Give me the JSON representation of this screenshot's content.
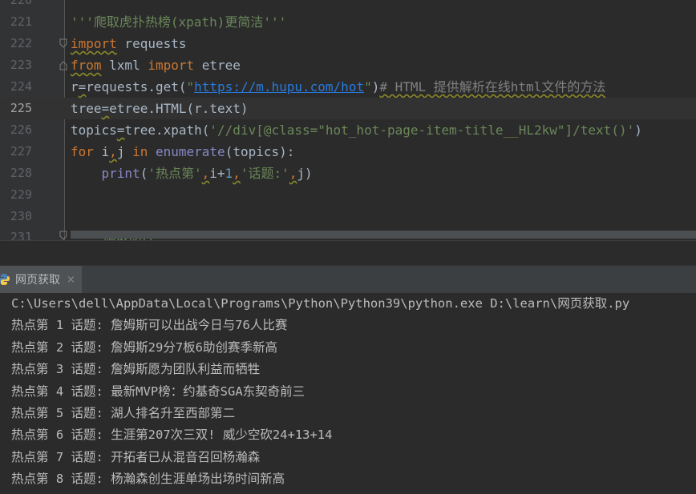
{
  "editor": {
    "partial_top_line_number": "220",
    "partial_bottom_line_number": "231",
    "partial_bottom_line_text": "'''爬取图片'''",
    "current_line": "225",
    "lines": [
      {
        "num": "221",
        "parts": [
          {
            "t": "'''爬取虎扑热榜(xpath)更简洁'''",
            "c": "str"
          }
        ]
      },
      {
        "num": "222",
        "parts": [
          {
            "t": "import",
            "c": "kw squig"
          },
          {
            "t": " requests",
            "c": ""
          }
        ]
      },
      {
        "num": "223",
        "parts": [
          {
            "t": "from",
            "c": "kw squig"
          },
          {
            "t": " lxml ",
            "c": ""
          },
          {
            "t": "import",
            "c": "kw"
          },
          {
            "t": " etree",
            "c": ""
          }
        ]
      },
      {
        "num": "224",
        "parts": [
          {
            "t": "r",
            "c": ""
          },
          {
            "t": "=",
            "c": "squig"
          },
          {
            "t": "requests.get(",
            "c": ""
          },
          {
            "t": "\"",
            "c": "str"
          },
          {
            "t": "https://m.hupu.com/hot",
            "c": "url"
          },
          {
            "t": "\"",
            "c": "str"
          },
          {
            "t": ")",
            "c": ""
          },
          {
            "t": "# HTML 提供解析在线html文件的方法",
            "c": "cmt squig"
          }
        ]
      },
      {
        "num": "225",
        "parts": [
          {
            "t": "tree",
            "c": ""
          },
          {
            "t": "=",
            "c": "squig"
          },
          {
            "t": "etree.HTML(r.text)",
            "c": ""
          }
        ]
      },
      {
        "num": "226",
        "parts": [
          {
            "t": "topics",
            "c": ""
          },
          {
            "t": "=",
            "c": "squig"
          },
          {
            "t": "tree.xpath(",
            "c": ""
          },
          {
            "t": "'//div[@class=\"hot_hot-page-item-title__HL2kw\"]/text()'",
            "c": "str"
          },
          {
            "t": ")",
            "c": ""
          }
        ]
      },
      {
        "num": "227",
        "parts": [
          {
            "t": "for",
            "c": "kw"
          },
          {
            "t": " i",
            "c": ""
          },
          {
            "t": ",",
            "c": "kw squig"
          },
          {
            "t": "j ",
            "c": ""
          },
          {
            "t": "in",
            "c": "kw"
          },
          {
            "t": " ",
            "c": ""
          },
          {
            "t": "enumerate",
            "c": "bi"
          },
          {
            "t": "(topics):",
            "c": ""
          }
        ]
      },
      {
        "num": "228",
        "parts": [
          {
            "t": "    ",
            "c": ""
          },
          {
            "t": "print",
            "c": "bi"
          },
          {
            "t": "(",
            "c": ""
          },
          {
            "t": "'热点第'",
            "c": "str"
          },
          {
            "t": ",",
            "c": "kw squig"
          },
          {
            "t": "i+",
            "c": ""
          },
          {
            "t": "1",
            "c": "num"
          },
          {
            "t": ",",
            "c": "kw squig"
          },
          {
            "t": "'话题:'",
            "c": "str"
          },
          {
            "t": ",",
            "c": "kw squig"
          },
          {
            "t": "j)",
            "c": ""
          }
        ]
      },
      {
        "num": "229",
        "parts": []
      },
      {
        "num": "230",
        "parts": []
      }
    ]
  },
  "run_panel": {
    "tab_label": "网页获取",
    "close_glyph": "×",
    "console_lines": [
      "C:\\Users\\dell\\AppData\\Local\\Programs\\Python\\Python39\\python.exe D:\\learn\\网页获取.py",
      "热点第 1 话题: 詹姆斯可以出战今日与76人比赛",
      "热点第 2 话题: 詹姆斯29分7板6助创赛季新高",
      "热点第 3 话题: 詹姆斯愿为团队利益而牺牲",
      "热点第 4 话题: 最新MVP榜：约基奇SGA东契奇前三",
      "热点第 5 话题: 湖人排名升至西部第二",
      "热点第 6 话题: 生涯第207次三双! 威少空砍24+13+14",
      "热点第 7 话题: 开拓者已从混音召回杨瀚森",
      "热点第 8 话题: 杨瀚森创生涯单场出场时间新高"
    ]
  },
  "icons": {
    "fold_icon": "fold-marker-icon",
    "python_icon": "python-icon"
  },
  "colors": {
    "editor_bg": "#2b2b2b",
    "keyword": "#cc7832",
    "string": "#6a8759",
    "number": "#6897bb",
    "builtin": "#8888c6",
    "comment": "#808080",
    "url": "#287bde"
  }
}
